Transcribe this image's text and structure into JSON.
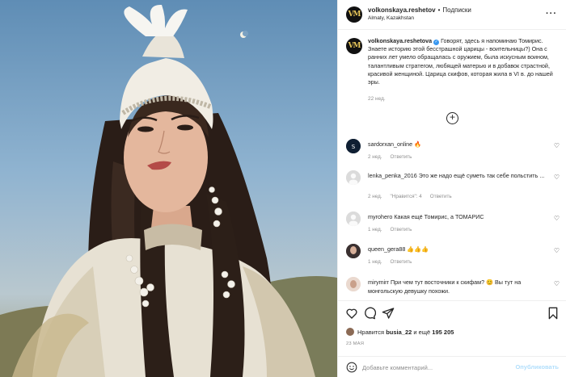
{
  "header": {
    "username": "volkonskaya.reshetov",
    "separator": "•",
    "follow_label": "Подписки",
    "location": "Almaty, Kazakhstan",
    "logo_text": "VM"
  },
  "caption": {
    "username": "volkonskaya.reshetova",
    "text": "Говорят, здесь я напоминаю Томирис. Знаете историю этой бесстрашной царицы - воительницы?) Она с ранних лет умело обращалась с оружием, была искусным воином, талантливым стратегом, любящей матерью и в добавок страстной, красивой женщиной. Царица скифов, которая жила в VI в. до нашей эры.",
    "time": "22 нед."
  },
  "comments": [
    {
      "username": "sardorxan_online",
      "text": "🔥",
      "time": "2 нед.",
      "reply": "Ответить",
      "likes": ""
    },
    {
      "username": "lenka_penka_2016",
      "text": "Это же надо ещё суметь так себе польстить ...",
      "time": "2 нед.",
      "reply": "Ответить",
      "likes": "\"Нравится\": 4"
    },
    {
      "username": "myrohero",
      "text": "Какая ещё Томирис, а ТОМАРИС",
      "time": "1 нед.",
      "reply": "Ответить",
      "likes": ""
    },
    {
      "username": "queen_gera88",
      "text": "👍👍👍",
      "time": "1 нед.",
      "reply": "Ответить",
      "likes": ""
    },
    {
      "username": "mirymirr",
      "text": "При чем тут восточники к скифам? 😊 Вы тут на монгольскую девушку похожи.",
      "time": "",
      "reply": "",
      "likes": ""
    }
  ],
  "actions": {
    "likes_prefix": "Нравится",
    "liked_by": "busia_22",
    "likes_mid": "и ещё",
    "likes_count": "195 205",
    "date": "23 МАЯ"
  },
  "add_comment": {
    "placeholder": "Добавьте комментарий...",
    "publish_label": "Опубликовать"
  },
  "colors": {
    "accent": "#3897f0",
    "publish_disabled": "#b2dffc",
    "meta_text": "#8e8e8e",
    "logo_gold": "#e8c75a"
  }
}
